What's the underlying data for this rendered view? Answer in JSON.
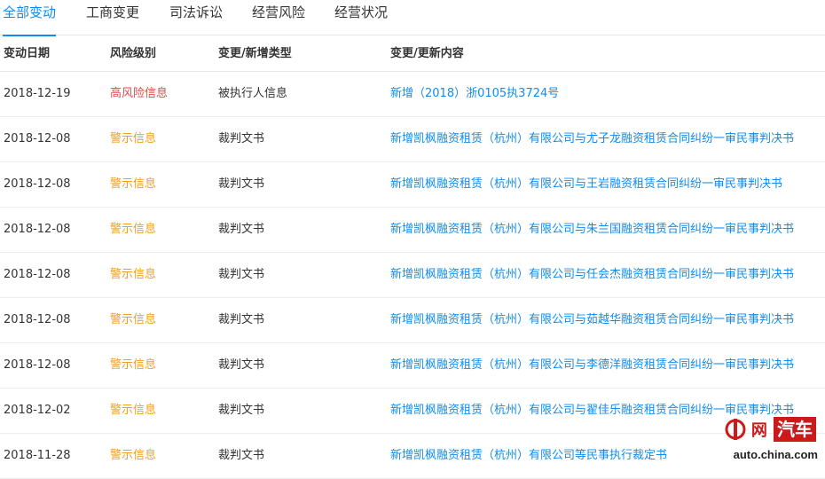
{
  "tabs": [
    {
      "label": "全部变动"
    },
    {
      "label": "工商变更"
    },
    {
      "label": "司法诉讼"
    },
    {
      "label": "经营风险"
    },
    {
      "label": "经营状况"
    }
  ],
  "table": {
    "headers": {
      "date": "变动日期",
      "risk": "风险级别",
      "type": "变更/新增类型",
      "content": "变更/更新内容"
    },
    "rows": [
      {
        "date": "2018-12-19",
        "risk": "高风险信息",
        "type": "被执行人信息",
        "content": "新增（2018）浙0105执3724号"
      },
      {
        "date": "2018-12-08",
        "risk": "警示信息",
        "type": "裁判文书",
        "content": "新增凯枫融资租赁（杭州）有限公司与尤子龙融资租赁合同纠纷一审民事判决书"
      },
      {
        "date": "2018-12-08",
        "risk": "警示信息",
        "type": "裁判文书",
        "content": "新增凯枫融资租赁（杭州）有限公司与王岩融资租赁合同纠纷一审民事判决书"
      },
      {
        "date": "2018-12-08",
        "risk": "警示信息",
        "type": "裁判文书",
        "content": "新增凯枫融资租赁（杭州）有限公司与朱兰国融资租赁合同纠纷一审民事判决书"
      },
      {
        "date": "2018-12-08",
        "risk": "警示信息",
        "type": "裁判文书",
        "content": "新增凯枫融资租赁（杭州）有限公司与任会杰融资租赁合同纠纷一审民事判决书"
      },
      {
        "date": "2018-12-08",
        "risk": "警示信息",
        "type": "裁判文书",
        "content": "新增凯枫融资租赁（杭州）有限公司与茹越华融资租赁合同纠纷一审民事判决书"
      },
      {
        "date": "2018-12-08",
        "risk": "警示信息",
        "type": "裁判文书",
        "content": "新增凯枫融资租赁（杭州）有限公司与李德洋融资租赁合同纠纷一审民事判决书"
      },
      {
        "date": "2018-12-02",
        "risk": "警示信息",
        "type": "裁判文书",
        "content": "新增凯枫融资租赁（杭州）有限公司与翟佳乐融资租赁合同纠纷一审民事判决书"
      },
      {
        "date": "2018-11-28",
        "risk": "警示信息",
        "type": "裁判文书",
        "content": "新增凯枫融资租赁（杭州）有限公司等民事执行裁定书"
      }
    ]
  },
  "watermark": {
    "brand_zh": "网",
    "brand_qiche": "汽车",
    "url": "auto.china.com"
  },
  "colors": {
    "accent": "#128bed",
    "risk_high": "#e24a4a",
    "risk_warn": "#f0a020",
    "watermark_red": "#cc1a1a"
  }
}
